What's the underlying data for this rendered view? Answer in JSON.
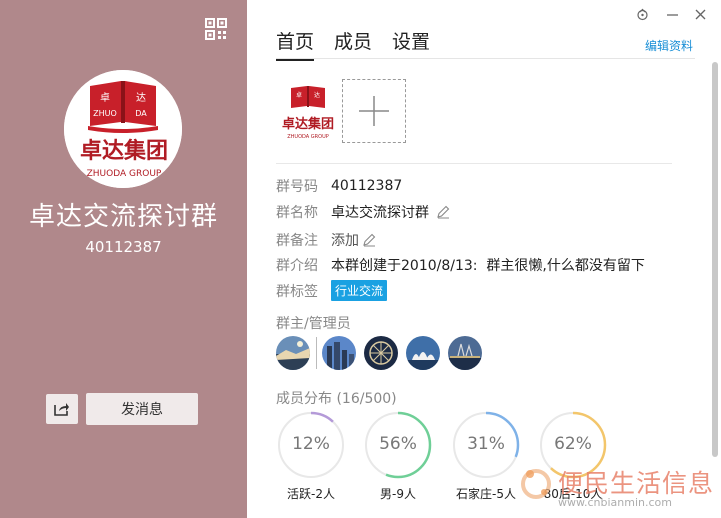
{
  "left_panel": {
    "group_name": "卓达交流探讨群",
    "group_id": "40112387",
    "send_message": "发消息",
    "logo_text": "卓达集团"
  },
  "tabs": [
    {
      "label": "首页",
      "active": true
    },
    {
      "label": "成员",
      "active": false
    },
    {
      "label": "设置",
      "active": false
    }
  ],
  "edit_profile": "编辑资料",
  "info": {
    "id_label": "群号码",
    "id_value": "40112387",
    "name_label": "群名称",
    "name_value": "卓达交流探讨群",
    "remark_label": "群备注",
    "remark_value": "添加",
    "intro_label": "群介绍",
    "intro_value": "本群创建于2010/8/13:  群主很懒,什么都没有留下",
    "tag_label": "群标签",
    "tag_value": "行业交流"
  },
  "admins_title": "群主/管理员",
  "distribution": {
    "title": "成员分布 (16/500)",
    "items": [
      {
        "percent": "12%",
        "label": "活跃-2人",
        "fraction": 0.12,
        "color": "#b49ad8"
      },
      {
        "percent": "56%",
        "label": "男-9人",
        "fraction": 0.56,
        "color": "#6fcf97"
      },
      {
        "percent": "31%",
        "label": "石家庄-5人",
        "fraction": 0.31,
        "color": "#7fb2e8"
      },
      {
        "percent": "62%",
        "label": "80后-10人",
        "fraction": 0.62,
        "color": "#f3c66b"
      }
    ]
  },
  "watermark": {
    "text": "便民生活信息",
    "url": "www.cnbianmin.com"
  }
}
